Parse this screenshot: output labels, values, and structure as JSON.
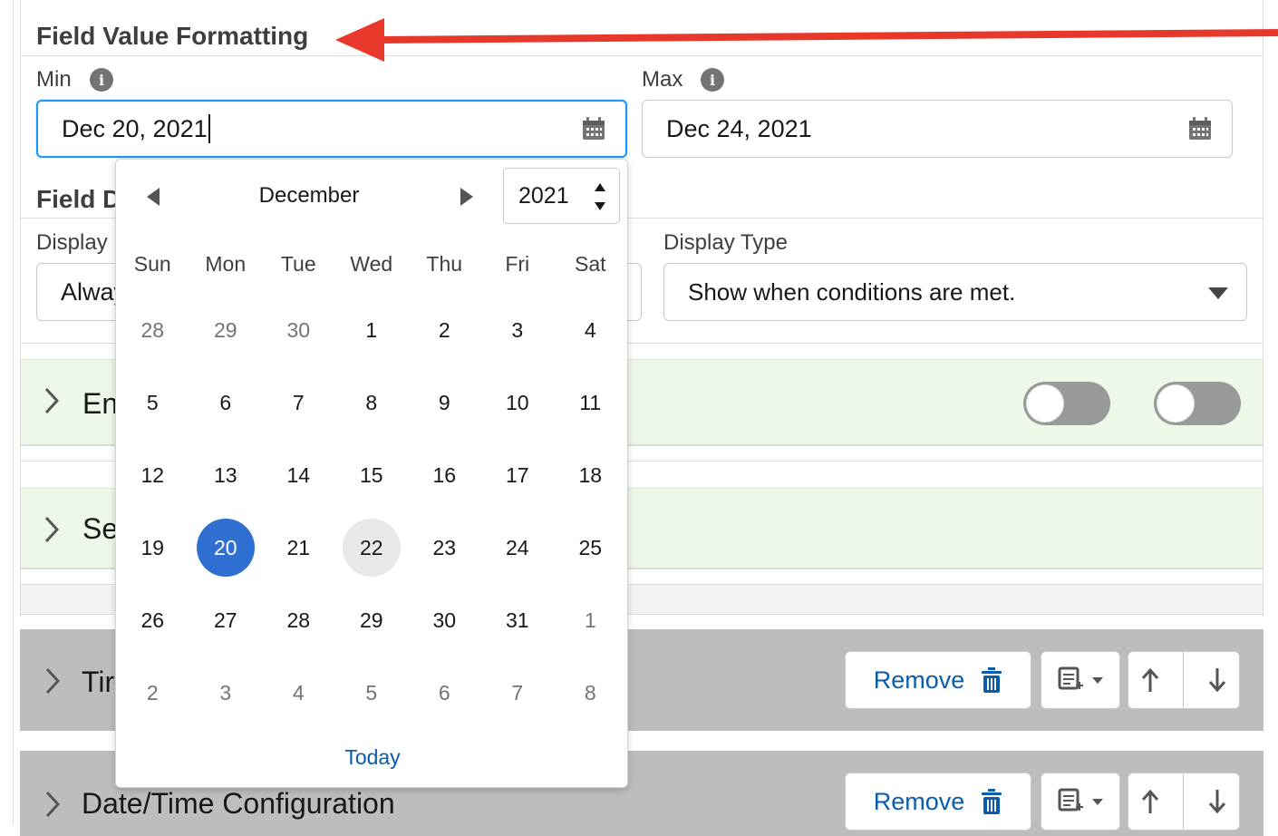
{
  "formatting": {
    "title": "Field Value Formatting",
    "min_label": "Min",
    "max_label": "Max",
    "min_value": "Dec 20, 2021",
    "max_value": "Dec 24, 2021"
  },
  "display": {
    "title_partial": "Field D",
    "display_label_partial": "Display",
    "display_value_partial": "Alway",
    "type_label": "Display Type",
    "type_value": "Show when conditions are met."
  },
  "sections": {
    "sec1_partial": "En",
    "sec2_partial": "Se",
    "bar1_partial": "Tir",
    "bar2_title": "Date/Time Configuration",
    "remove_label": "Remove"
  },
  "datepicker": {
    "month": "December",
    "year": "2021",
    "weekdays": [
      "Sun",
      "Mon",
      "Tue",
      "Wed",
      "Thu",
      "Fri",
      "Sat"
    ],
    "weeks": [
      [
        "28",
        "29",
        "30",
        "1",
        "2",
        "3",
        "4"
      ],
      [
        "5",
        "6",
        "7",
        "8",
        "9",
        "10",
        "11"
      ],
      [
        "12",
        "13",
        "14",
        "15",
        "16",
        "17",
        "18"
      ],
      [
        "19",
        "20",
        "21",
        "22",
        "23",
        "24",
        "25"
      ],
      [
        "26",
        "27",
        "28",
        "29",
        "30",
        "31",
        "1"
      ],
      [
        "2",
        "3",
        "4",
        "5",
        "6",
        "7",
        "8"
      ]
    ],
    "selected_day": "20",
    "today_day": "22",
    "today_label": "Today"
  },
  "colors": {
    "annotation_arrow": "#e8382b",
    "selected_day": "#2f6fd1",
    "link": "#0b5cab",
    "section_bg": "#eef8e9",
    "bar_bg": "#bdbdbd"
  },
  "icons": [
    "info-icon",
    "calendar-icon",
    "chevron-right-icon",
    "caret-down-icon",
    "trash-icon",
    "add-note-icon",
    "arrow-up-icon",
    "arrow-down-icon",
    "triangle-left-icon",
    "triangle-right-icon"
  ]
}
